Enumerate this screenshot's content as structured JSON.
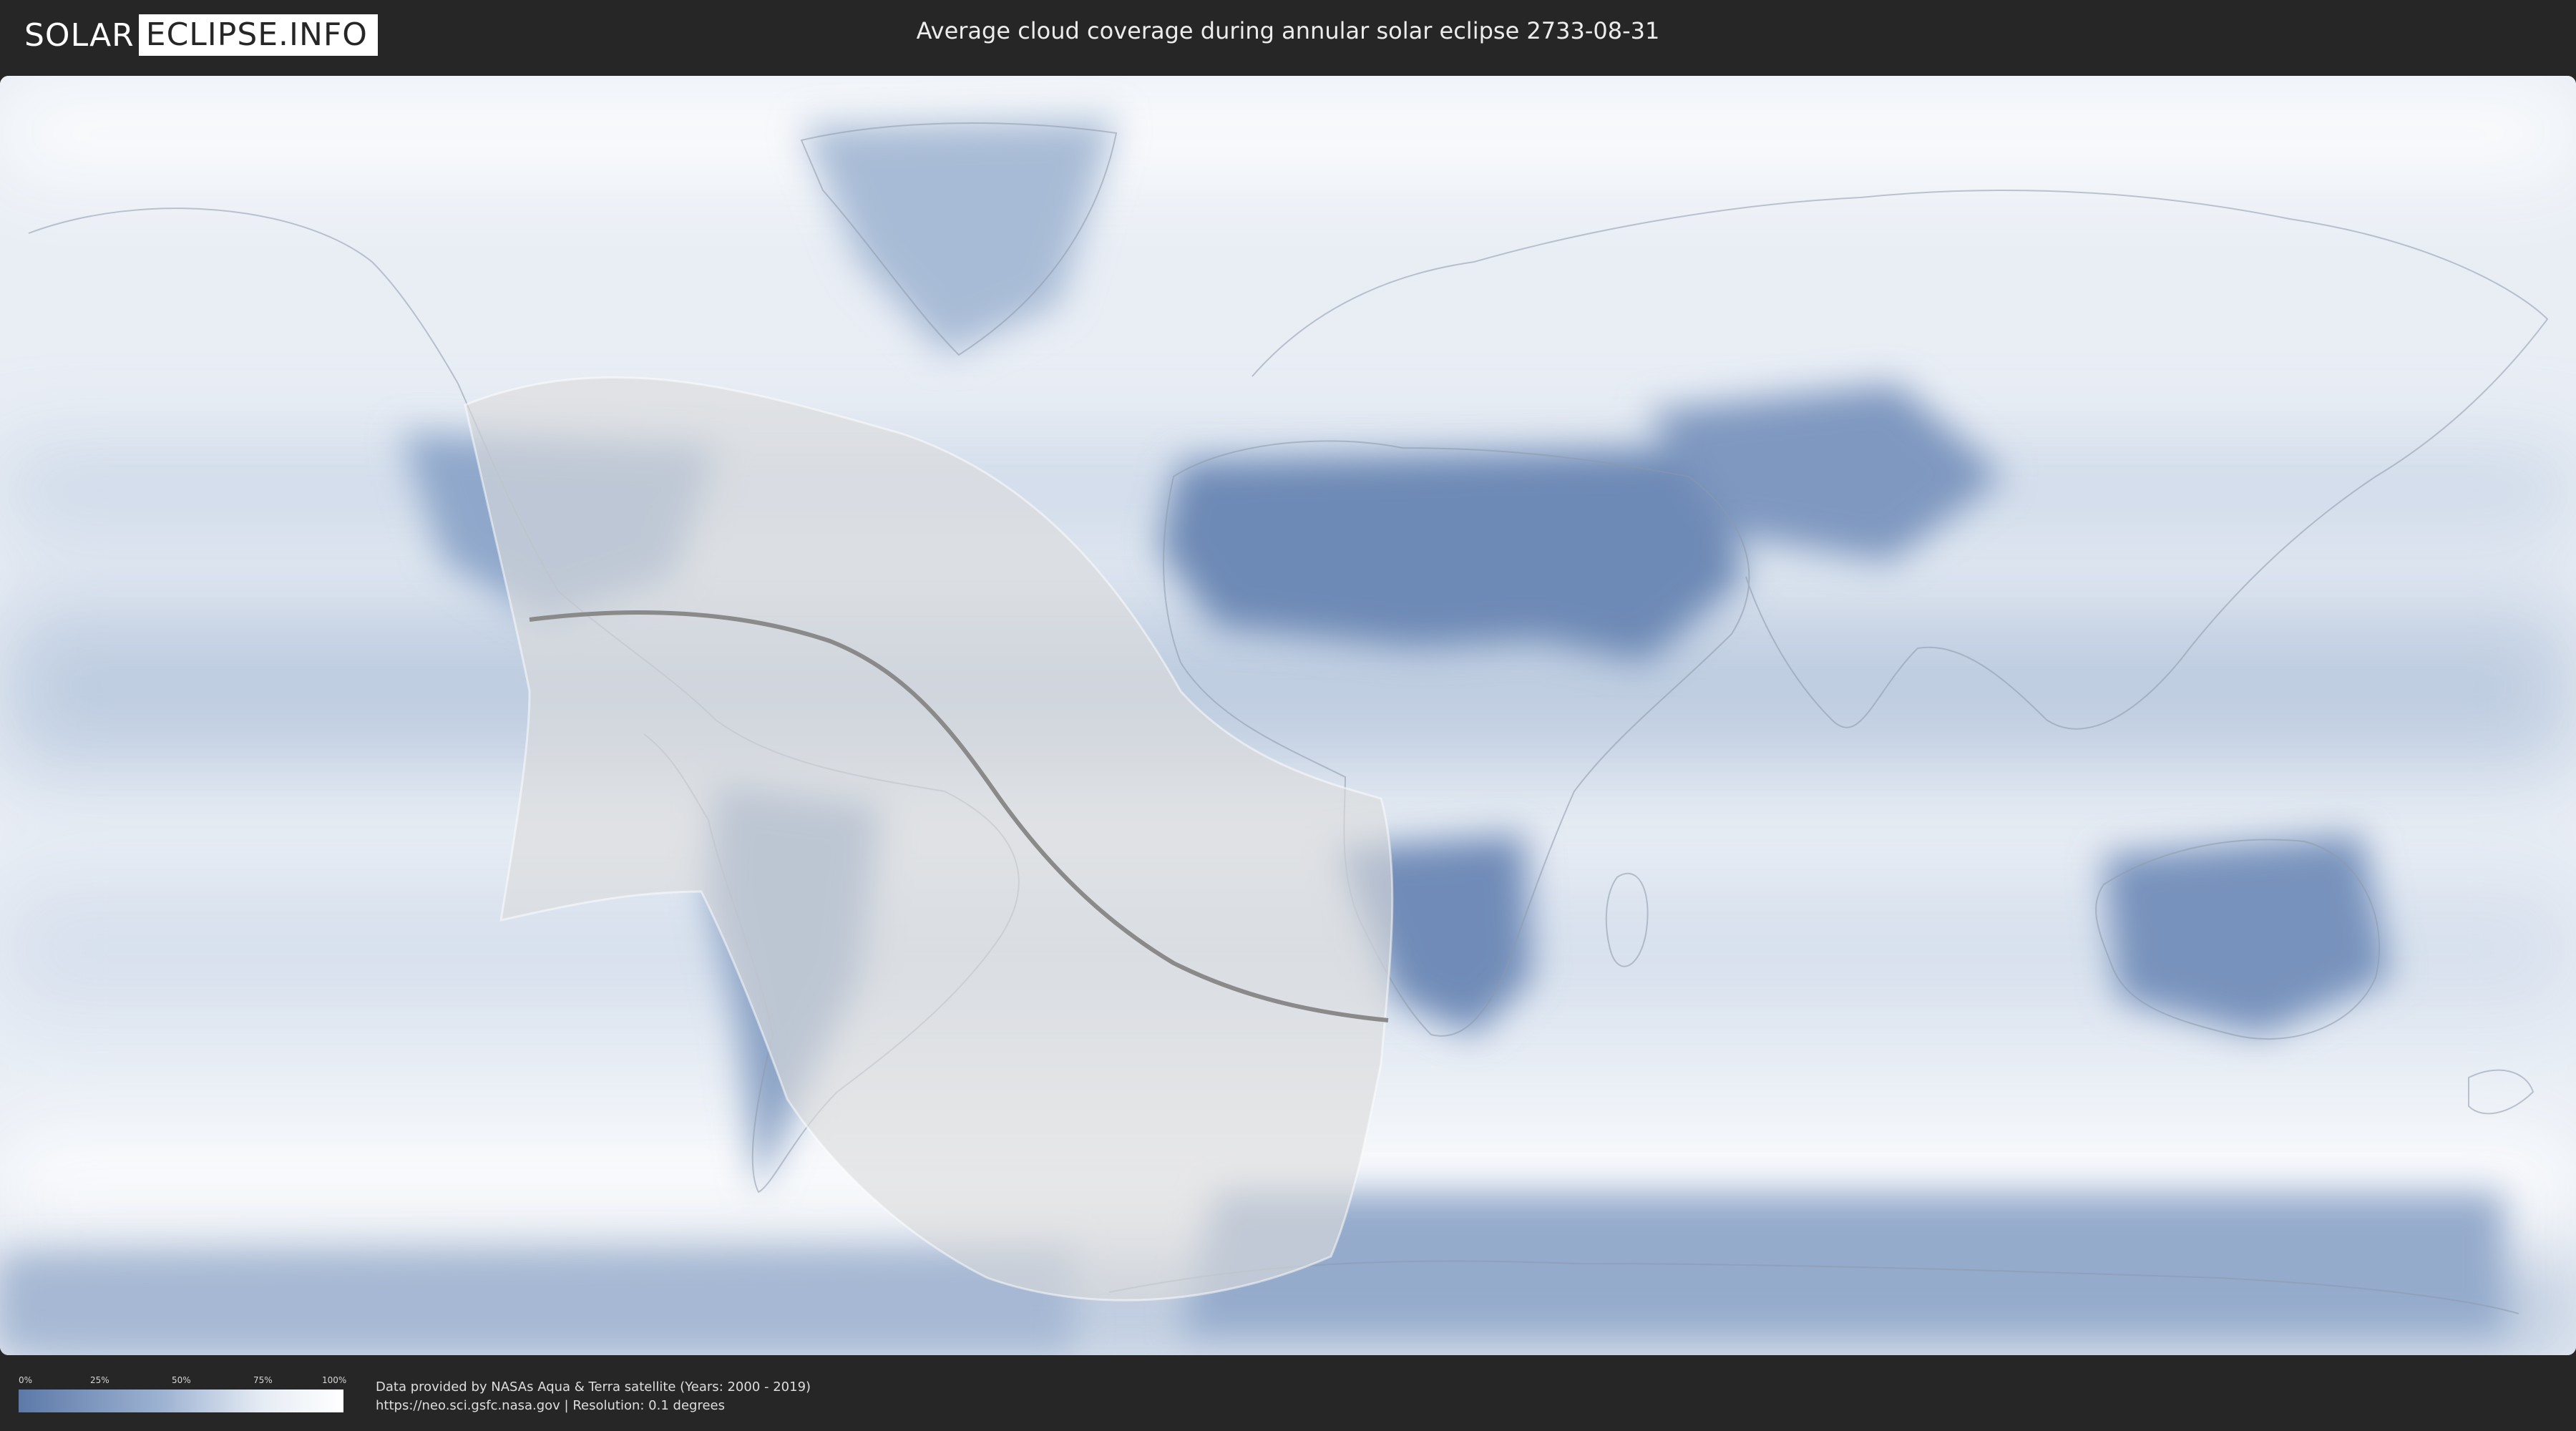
{
  "header": {
    "logo_part1": "SOLAR",
    "logo_part2": "ECLIPSE.INFO",
    "title": "Average cloud coverage during annular solar eclipse 2733-08-31"
  },
  "legend": {
    "ticks": [
      "0%",
      "25%",
      "50%",
      "75%",
      "100%"
    ],
    "values": [
      0,
      25,
      50,
      75,
      100
    ],
    "color_low": "#5c79a8",
    "color_high": "#ffffff"
  },
  "credits": {
    "line1": "Data provided by NASAs Aqua & Terra satellite (Years: 2000 - 2019)",
    "line2": "https://neo.sci.gsfc.nasa.gov | Resolution: 0.1 degrees"
  },
  "map": {
    "projection": "equirectangular",
    "layers": [
      "cloud-coverage",
      "coastlines",
      "eclipse-visibility-zone",
      "central-line"
    ],
    "colors": {
      "clear_sky": "#6d89b5",
      "cloudy": "#f2f5f9",
      "eclipse_zone": "#dedede",
      "central_line": "#8a8a8a"
    }
  }
}
